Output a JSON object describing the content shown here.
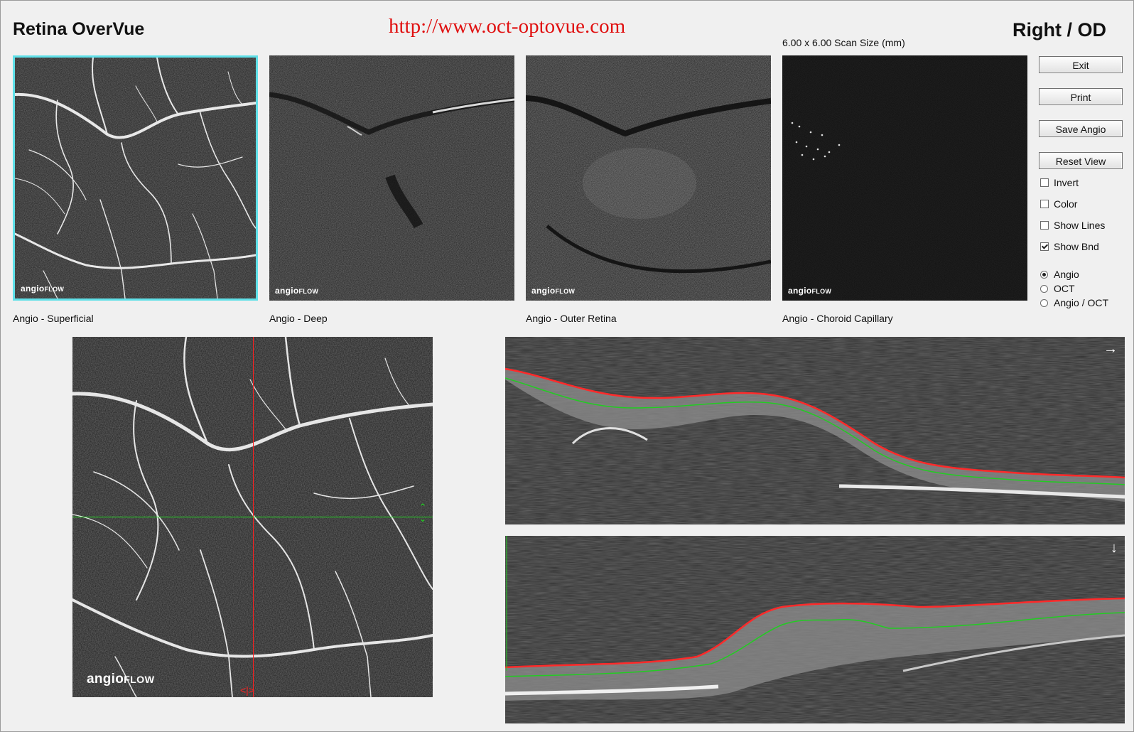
{
  "header": {
    "app_title": "Retina OverVue",
    "url": "http://www.oct-optovue.com",
    "eye": "Right / OD",
    "scan_size": "6.00 x 6.00 Scan Size (mm)"
  },
  "thumbnails": [
    {
      "caption": "Angio - Superficial",
      "selected": true,
      "brand": "angio",
      "brand_sub": "FLOW"
    },
    {
      "caption": "Angio - Deep",
      "selected": false,
      "brand": "angio",
      "brand_sub": "FLOW"
    },
    {
      "caption": "Angio - Outer Retina",
      "selected": false,
      "brand": "angio",
      "brand_sub": "FLOW"
    },
    {
      "caption": "Angio - Choroid Capillary",
      "selected": false,
      "brand": "angio",
      "brand_sub": "FLOW"
    }
  ],
  "buttons": {
    "exit": "Exit",
    "print": "Print",
    "save_angio": "Save Angio",
    "reset_view": "Reset View"
  },
  "checkboxes": [
    {
      "label": "Invert",
      "checked": false
    },
    {
      "label": "Color",
      "checked": false
    },
    {
      "label": "Show Lines",
      "checked": false
    },
    {
      "label": "Show Bnd",
      "checked": true
    }
  ],
  "view_mode": {
    "options": [
      "Angio",
      "OCT",
      "Angio / OCT"
    ],
    "selected": "Angio"
  },
  "main_view": {
    "brand": "angio",
    "brand_sub": "FLOW"
  },
  "bscans": {
    "horizontal_arrow": "→",
    "vertical_arrow": "↓"
  },
  "colors": {
    "selection_border": "#5fe0e8",
    "url_red": "#e01010",
    "crosshair_red": "#ff2020",
    "crosshair_green": "#22dd22"
  }
}
